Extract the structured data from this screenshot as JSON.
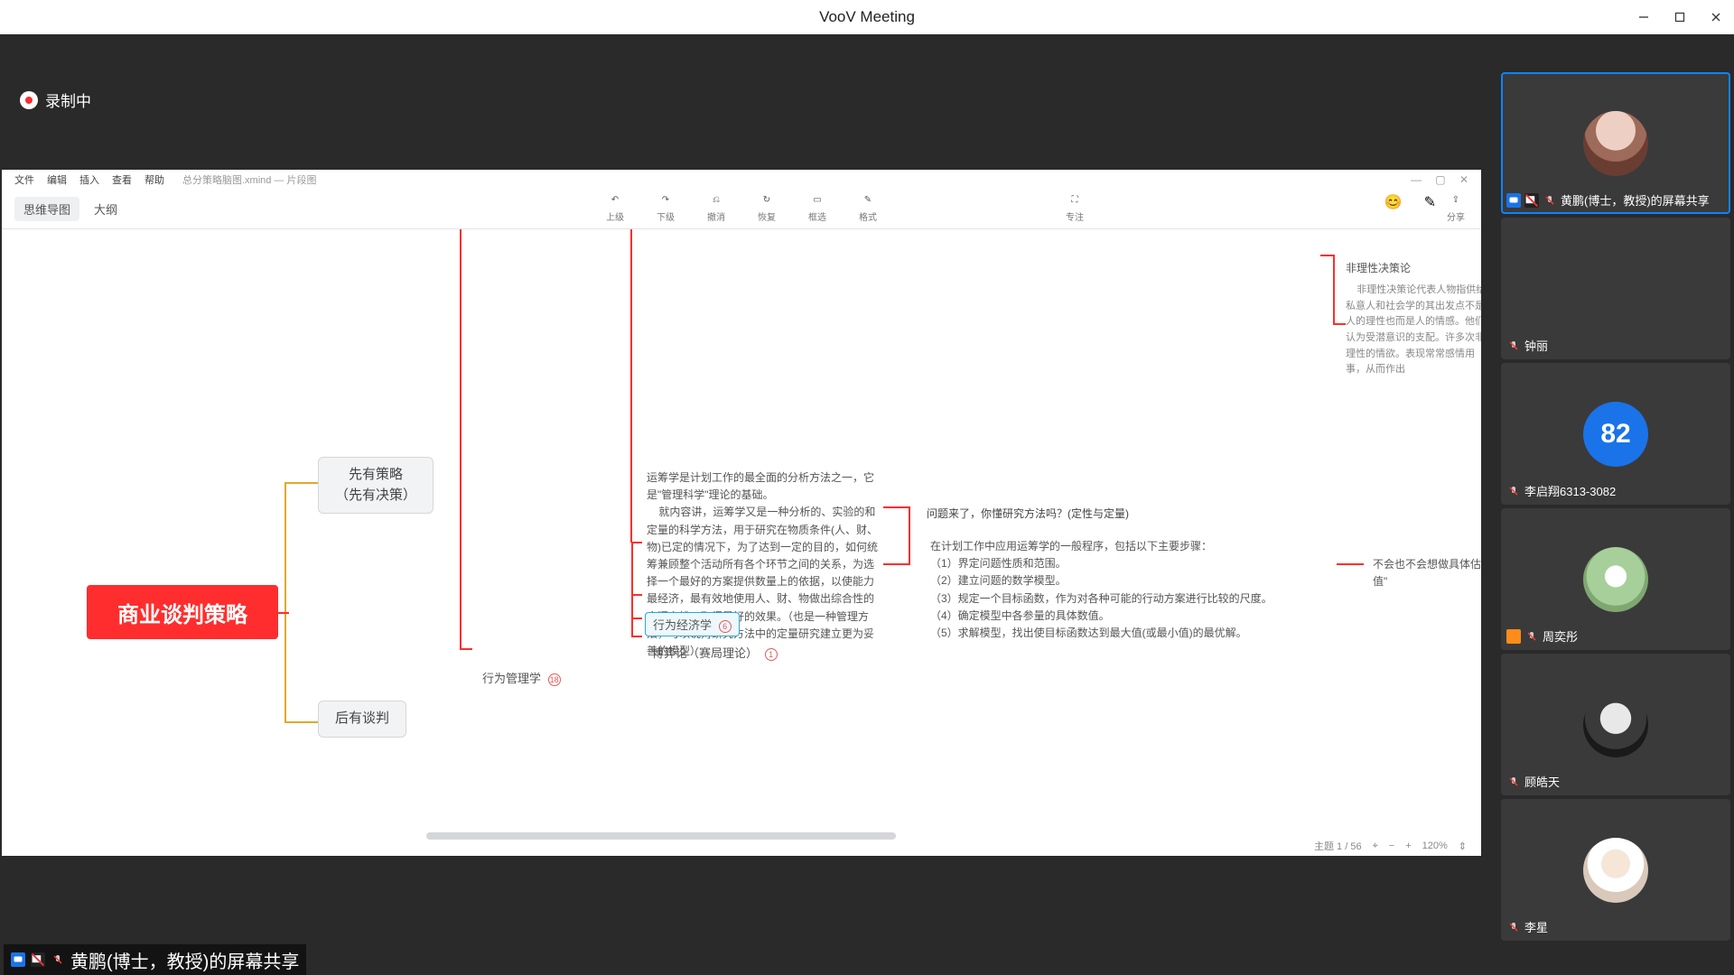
{
  "app": {
    "title": "VooV Meeting"
  },
  "recording": {
    "label": "录制中"
  },
  "share": {
    "menu": [
      "文件",
      "编辑",
      "插入",
      "查看",
      "帮助"
    ],
    "doc_hint": "总分策略脑图.xmind — 片段图",
    "tabs": {
      "main": "思维导图",
      "outline": "大纲"
    },
    "tools": {
      "prev": "上级",
      "next": "下级",
      "undo": "撤消",
      "redo": "恢复",
      "frame": "框选",
      "format": "格式"
    },
    "tools_right": {
      "focus": "专注",
      "share": "分享"
    },
    "emoji": "😊",
    "brush": "✎"
  },
  "mindmap": {
    "root": "商业谈判策略",
    "first_strategy_l1": "先有策略",
    "first_strategy_l2": "（先有决策）",
    "negotiation": "后有谈判",
    "op_research": "运筹学是计划工作的最全面的分析方法之一，它是\"管理科学\"理论的基础。\n    就内容讲，运筹学又是一种分析的、实验的和定量的科学方法，用于研究在物质条件(人、财、物)已定的情况下，为了达到一定的目的，如何统筹兼顾整个活动所有各个环节之间的关系，为选择一个最好的方案提供数量上的依据，以使能力最经济，最有效地使用人、财、物做出综合性的合理安排，取得最好的效果。（也是一种管理方法，可以说对研究方法中的定量研究建立更为妥善的模型）",
    "question": "问题来了，你懂研究方法吗？(定性与定量)",
    "steps_intro": "在计划工作中应用运筹学的一般程序，包括以下主要步骤：",
    "steps": [
      "（1）界定问题性质和范围。",
      "（2）建立问题的数学模型。",
      "（3）规定一个目标函数，作为对各种可能的行动方案进行比较的尺度。",
      "（4）确定模型中各参量的具体数值。",
      "（5）求解模型，找出使目标函数达到最大值(或最小值)的最优解。"
    ],
    "side": "不会也不会想做具体估值\"",
    "non_rational": {
      "title": "非理性决策论",
      "body": "    非理性决策论代表人物指供给私意人和社会学的其出发点不是人的理性也而是人的情感。他们认为受潜意识的支配。许多次非理性的情欲。表现常常感情用事，从而作出"
    },
    "behavioral": "行为经济学",
    "behavioral_badge": "6",
    "game_theory": "博弈论（赛局理论）",
    "game_theory_badge": "1",
    "mgmt": "行为管理学",
    "mgmt_badge": "18"
  },
  "statusbar": {
    "pages": "主题 1 / 56",
    "zoom": "120%"
  },
  "participants": [
    {
      "name": "黄鹏(博士，教授)的屏幕共享",
      "avatar_class": "av1",
      "sharing": true,
      "muted": true,
      "video_badge": true
    },
    {
      "name": "钟丽",
      "no_avatar": true,
      "muted": true
    },
    {
      "name": "李启翔6313-3082",
      "num": "82",
      "muted": true
    },
    {
      "name": "周奕彤",
      "avatar_class": "av2",
      "muted": true,
      "orange_badge": true
    },
    {
      "name": "顾皓天",
      "avatar_class": "av3",
      "muted": true
    },
    {
      "name": "李星",
      "avatar_class": "av4",
      "muted": true
    }
  ],
  "presenter": "黄鹏(博士，教授)的屏幕共享"
}
